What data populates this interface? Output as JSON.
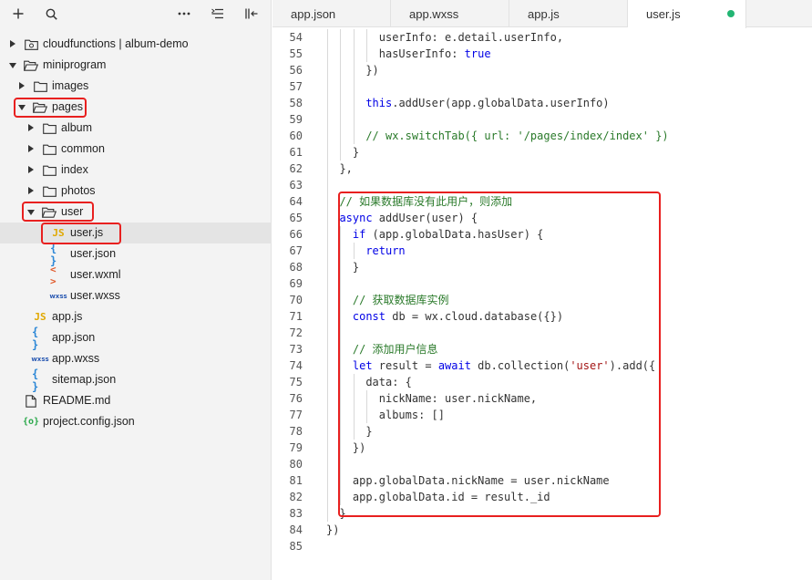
{
  "toolbar": {
    "add_icon": "plus-icon",
    "search_icon": "search-icon",
    "more_icon": "ellipsis-icon",
    "collapse_icon": "collapse-icon",
    "layout_icon": "layout-icon"
  },
  "tree": [
    {
      "label": "cloudfunctions | album-demo",
      "type": "cloud-folder",
      "arrow": "right"
    },
    {
      "label": "miniprogram",
      "type": "folder-open",
      "arrow": "down"
    },
    {
      "label": "images",
      "type": "folder",
      "arrow": "right"
    },
    {
      "label": "pages",
      "type": "folder-open",
      "arrow": "down"
    },
    {
      "label": "album",
      "type": "folder",
      "arrow": "right"
    },
    {
      "label": "common",
      "type": "folder",
      "arrow": "right"
    },
    {
      "label": "index",
      "type": "folder",
      "arrow": "right"
    },
    {
      "label": "photos",
      "type": "folder",
      "arrow": "right"
    },
    {
      "label": "user",
      "type": "folder-open",
      "arrow": "down"
    },
    {
      "label": "user.js",
      "type": "js",
      "icon_text": "JS"
    },
    {
      "label": "user.json",
      "type": "json",
      "icon_text": "{ }"
    },
    {
      "label": "user.wxml",
      "type": "wxml",
      "icon_text": "< >"
    },
    {
      "label": "user.wxss",
      "type": "wxss",
      "icon_text": "wxss"
    },
    {
      "label": "app.js",
      "type": "js",
      "icon_text": "JS"
    },
    {
      "label": "app.json",
      "type": "json",
      "icon_text": "{ }"
    },
    {
      "label": "app.wxss",
      "type": "wxss",
      "icon_text": "wxss"
    },
    {
      "label": "sitemap.json",
      "type": "json",
      "icon_text": "{ }"
    },
    {
      "label": "README.md",
      "type": "file"
    },
    {
      "label": "project.config.json",
      "type": "cfg",
      "icon_text": "{o}"
    }
  ],
  "tabs": [
    {
      "label": "app.json"
    },
    {
      "label": "app.wxss"
    },
    {
      "label": "app.js"
    },
    {
      "label": "user.js",
      "active": true
    }
  ],
  "colors": {
    "accent_red": "#e8201f",
    "modified_dot": "#22b573",
    "keyword": "#0000e6",
    "string": "#a31515",
    "comment": "#2a7a2a"
  },
  "code_lines": [
    {
      "n": "54",
      "indent": 8,
      "tokens": [
        [
          "userInfo: e.detail.userInfo,",
          ""
        ]
      ]
    },
    {
      "n": "55",
      "indent": 8,
      "tokens": [
        [
          "hasUserInfo: ",
          ""
        ],
        [
          "true",
          "kw"
        ]
      ]
    },
    {
      "n": "56",
      "indent": 6,
      "tokens": [
        [
          "})",
          ""
        ]
      ]
    },
    {
      "n": "57",
      "indent": 0,
      "tokens": []
    },
    {
      "n": "58",
      "indent": 6,
      "tokens": [
        [
          "this",
          "kw"
        ],
        [
          ".addUser(app.globalData.userInfo)",
          ""
        ]
      ]
    },
    {
      "n": "59",
      "indent": 0,
      "tokens": []
    },
    {
      "n": "60",
      "indent": 6,
      "tokens": [
        [
          "// wx.switchTab({ url: '/pages/index/index' })",
          "cm"
        ]
      ]
    },
    {
      "n": "61",
      "indent": 4,
      "tokens": [
        [
          "}",
          ""
        ]
      ]
    },
    {
      "n": "62",
      "indent": 2,
      "tokens": [
        [
          "},",
          ""
        ]
      ]
    },
    {
      "n": "63",
      "indent": 0,
      "tokens": []
    },
    {
      "n": "64",
      "indent": 2,
      "tokens": [
        [
          "// 如果数据库没有此用户，则添加",
          "cm"
        ]
      ]
    },
    {
      "n": "65",
      "indent": 2,
      "tokens": [
        [
          "async",
          "kw"
        ],
        [
          " addUser(user) {",
          ""
        ]
      ]
    },
    {
      "n": "66",
      "indent": 4,
      "tokens": [
        [
          "if",
          "kw"
        ],
        [
          " (app.globalData.hasUser) {",
          ""
        ]
      ]
    },
    {
      "n": "67",
      "indent": 6,
      "tokens": [
        [
          "return",
          "kw"
        ]
      ]
    },
    {
      "n": "68",
      "indent": 4,
      "tokens": [
        [
          "}",
          ""
        ]
      ]
    },
    {
      "n": "69",
      "indent": 0,
      "tokens": []
    },
    {
      "n": "70",
      "indent": 4,
      "tokens": [
        [
          "// 获取数据库实例",
          "cm"
        ]
      ]
    },
    {
      "n": "71",
      "indent": 4,
      "tokens": [
        [
          "const",
          "kw"
        ],
        [
          " db = wx.cloud.database({})",
          ""
        ]
      ]
    },
    {
      "n": "72",
      "indent": 0,
      "tokens": []
    },
    {
      "n": "73",
      "indent": 4,
      "tokens": [
        [
          "// 添加用户信息",
          "cm"
        ]
      ]
    },
    {
      "n": "74",
      "indent": 4,
      "tokens": [
        [
          "let",
          "kw"
        ],
        [
          " result = ",
          ""
        ],
        [
          "await",
          "kw"
        ],
        [
          " db.collection(",
          ""
        ],
        [
          "'user'",
          "str"
        ],
        [
          ").add({",
          ""
        ]
      ]
    },
    {
      "n": "75",
      "indent": 6,
      "tokens": [
        [
          "data: {",
          ""
        ]
      ]
    },
    {
      "n": "76",
      "indent": 8,
      "tokens": [
        [
          "nickName: user.nickName,",
          ""
        ]
      ]
    },
    {
      "n": "77",
      "indent": 8,
      "tokens": [
        [
          "albums: []",
          ""
        ]
      ]
    },
    {
      "n": "78",
      "indent": 6,
      "tokens": [
        [
          "}",
          ""
        ]
      ]
    },
    {
      "n": "79",
      "indent": 4,
      "tokens": [
        [
          "})",
          ""
        ]
      ]
    },
    {
      "n": "80",
      "indent": 0,
      "tokens": []
    },
    {
      "n": "81",
      "indent": 4,
      "tokens": [
        [
          "app.globalData.nickName = user.nickName",
          ""
        ]
      ]
    },
    {
      "n": "82",
      "indent": 4,
      "tokens": [
        [
          "app.globalData.id = result._id",
          ""
        ]
      ]
    },
    {
      "n": "83",
      "indent": 2,
      "tokens": [
        [
          "}",
          ""
        ]
      ]
    },
    {
      "n": "84",
      "indent": 0,
      "tokens": [
        [
          "})",
          ""
        ]
      ]
    },
    {
      "n": "85",
      "indent": 0,
      "tokens": []
    }
  ]
}
